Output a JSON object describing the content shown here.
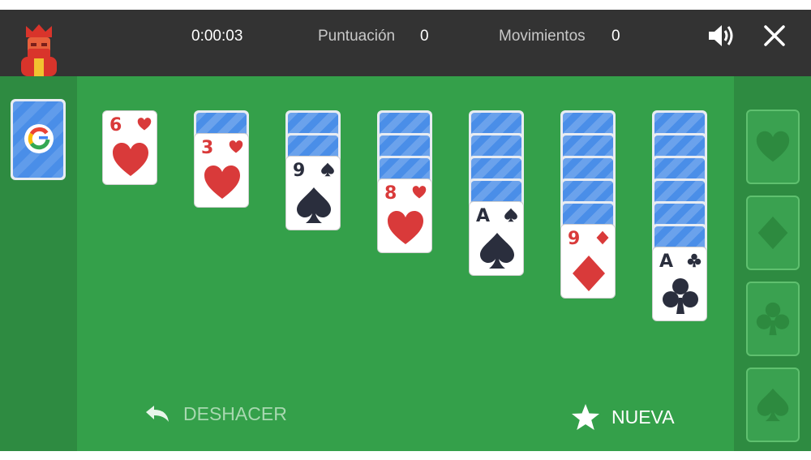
{
  "header": {
    "timer": "0:00:03",
    "score_label": "Puntuación",
    "score_value": "0",
    "moves_label": "Movimientos",
    "moves_value": "0",
    "sound_icon": "speaker-icon",
    "close_icon": "close-icon"
  },
  "stock": {
    "logo": "google-g-logo",
    "colors": [
      "#4285F4",
      "#EA4335",
      "#FBBC05",
      "#34A853"
    ]
  },
  "tableau": [
    {
      "hidden": 0,
      "card": {
        "rank": "6",
        "suit": "hearts"
      }
    },
    {
      "hidden": 1,
      "card": {
        "rank": "3",
        "suit": "hearts"
      }
    },
    {
      "hidden": 2,
      "card": {
        "rank": "9",
        "suit": "spades"
      }
    },
    {
      "hidden": 3,
      "card": {
        "rank": "8",
        "suit": "hearts"
      }
    },
    {
      "hidden": 4,
      "card": {
        "rank": "A",
        "suit": "spades"
      }
    },
    {
      "hidden": 5,
      "card": {
        "rank": "9",
        "suit": "diamonds"
      }
    },
    {
      "hidden": 6,
      "card": {
        "rank": "A",
        "suit": "clubs"
      }
    }
  ],
  "foundations": [
    "hearts",
    "diamonds",
    "clubs",
    "spades"
  ],
  "actions": {
    "undo_label": "DESHACER",
    "new_label": "NUEVA"
  },
  "colors": {
    "topbar": "#333333",
    "board": "#34a04a",
    "side": "#2e8b41",
    "red_suit": "#d93a3a",
    "black_suit": "#2a2e3d",
    "card_back": "#4a8ee8"
  }
}
